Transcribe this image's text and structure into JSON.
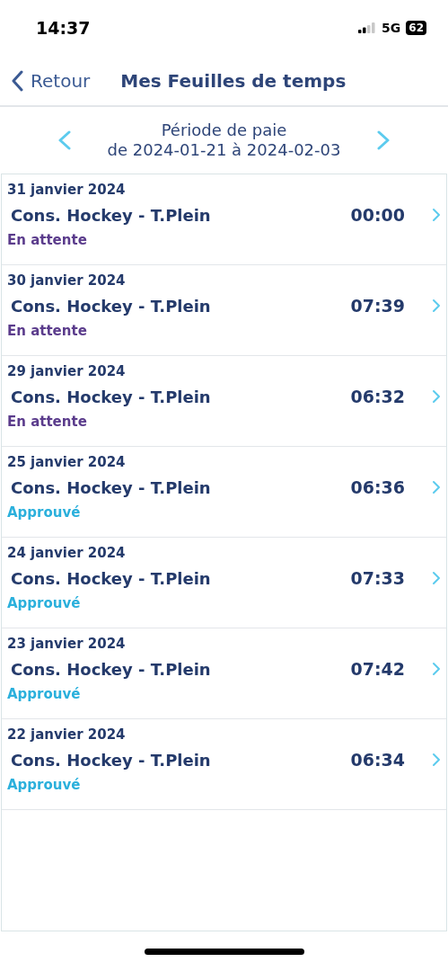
{
  "status_bar": {
    "time": "14:37",
    "network": "5G",
    "battery": "62"
  },
  "nav": {
    "back": "Retour",
    "title": "Mes Feuilles de temps"
  },
  "period": {
    "label": "Période de paie",
    "range": "de 2024-01-21 à 2024-02-03"
  },
  "entries": [
    {
      "date": "31 janvier 2024",
      "job": "Cons. Hockey - T.Plein",
      "hours": "00:00",
      "status": "En attente",
      "kind": "pending"
    },
    {
      "date": "30 janvier 2024",
      "job": "Cons. Hockey - T.Plein",
      "hours": "07:39",
      "status": "En attente",
      "kind": "pending"
    },
    {
      "date": "29 janvier 2024",
      "job": "Cons. Hockey - T.Plein",
      "hours": "06:32",
      "status": "En attente",
      "kind": "pending"
    },
    {
      "date": "25 janvier 2024",
      "job": "Cons. Hockey - T.Plein",
      "hours": "06:36",
      "status": "Approuvé",
      "kind": "approved"
    },
    {
      "date": "24 janvier 2024",
      "job": "Cons. Hockey - T.Plein",
      "hours": "07:33",
      "status": "Approuvé",
      "kind": "approved"
    },
    {
      "date": "23 janvier 2024",
      "job": "Cons. Hockey - T.Plein",
      "hours": "07:42",
      "status": "Approuvé",
      "kind": "approved"
    },
    {
      "date": "22 janvier 2024",
      "job": "Cons. Hockey - T.Plein",
      "hours": "06:34",
      "status": "Approuvé",
      "kind": "approved"
    }
  ]
}
